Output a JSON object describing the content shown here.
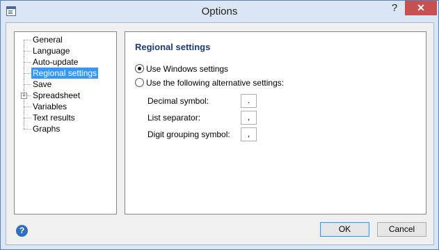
{
  "window": {
    "title": "Options",
    "help_caption": "?",
    "close_caption": "✕"
  },
  "tree": {
    "items": [
      {
        "label": "General",
        "selected": false,
        "expandable": false
      },
      {
        "label": "Language",
        "selected": false,
        "expandable": false
      },
      {
        "label": "Auto-update",
        "selected": false,
        "expandable": false
      },
      {
        "label": "Regional settings",
        "selected": true,
        "expandable": false
      },
      {
        "label": "Save",
        "selected": false,
        "expandable": false
      },
      {
        "label": "Spreadsheet",
        "selected": false,
        "expandable": true
      },
      {
        "label": "Variables",
        "selected": false,
        "expandable": false
      },
      {
        "label": "Text results",
        "selected": false,
        "expandable": false
      },
      {
        "label": "Graphs",
        "selected": false,
        "expandable": false
      }
    ],
    "expander_glyph": "+"
  },
  "panel": {
    "title": "Regional settings",
    "radio_windows": {
      "label": "Use Windows settings",
      "checked": true
    },
    "radio_alternative": {
      "label": "Use the following alternative settings:",
      "checked": false
    },
    "fields": [
      {
        "label": "Decimal symbol:",
        "value": "."
      },
      {
        "label": "List separator:",
        "value": ","
      },
      {
        "label": "Digit grouping symbol:",
        "value": ","
      }
    ]
  },
  "footer": {
    "help_glyph": "?",
    "ok_label": "OK",
    "cancel_label": "Cancel"
  },
  "colors": {
    "selection": "#3399ff",
    "panel_title": "#1a3a7a",
    "close_button": "#c75050"
  }
}
